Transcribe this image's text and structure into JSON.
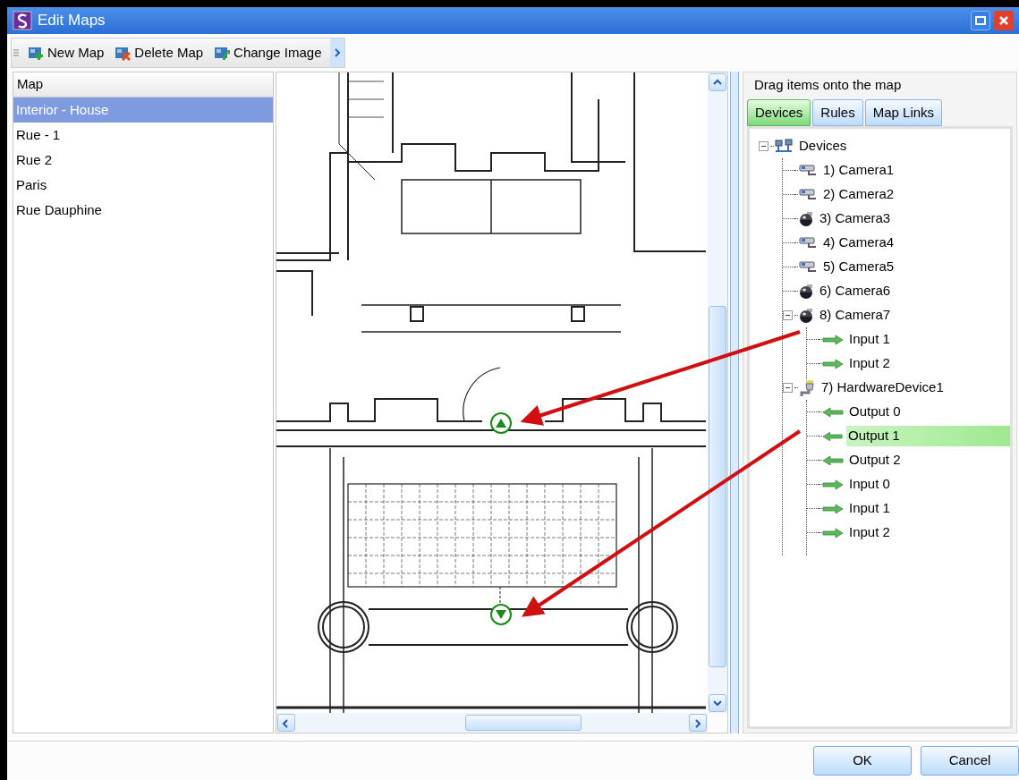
{
  "window": {
    "title": "Edit Maps"
  },
  "toolbar": [
    {
      "label": "New Map",
      "kind": "new"
    },
    {
      "label": "Delete Map",
      "kind": "delete"
    },
    {
      "label": "Change Image",
      "kind": "change"
    }
  ],
  "map_list": {
    "header": "Map",
    "items": [
      {
        "label": "Interior - House",
        "selected": true
      },
      {
        "label": "Rue - 1",
        "selected": false
      },
      {
        "label": "Rue 2",
        "selected": false
      },
      {
        "label": "Paris",
        "selected": false
      },
      {
        "label": "Rue Dauphine",
        "selected": false
      }
    ]
  },
  "panel": {
    "hint": "Drag items onto the map",
    "tabs": [
      {
        "label": "Devices",
        "selected": true
      },
      {
        "label": "Rules",
        "selected": false
      },
      {
        "label": "Map Links",
        "selected": false
      }
    ],
    "tree": [
      {
        "label": "Devices",
        "kind": "network",
        "expanded": true,
        "selected": false,
        "children": [
          {
            "label": "1) Camera1",
            "kind": "box-camera",
            "selected": false
          },
          {
            "label": "2) Camera2",
            "kind": "box-camera",
            "selected": false
          },
          {
            "label": "3) Camera3",
            "kind": "dome-camera",
            "selected": false
          },
          {
            "label": "4) Camera4",
            "kind": "box-camera",
            "selected": false
          },
          {
            "label": "5) Camera5",
            "kind": "box-camera",
            "selected": false
          },
          {
            "label": "6) Camera6",
            "kind": "dome-camera",
            "selected": false
          },
          {
            "label": "8) Camera7",
            "kind": "dome-camera",
            "expanded": true,
            "selected": false,
            "children": [
              {
                "label": "Input 1",
                "kind": "input",
                "selected": false
              },
              {
                "label": "Input 2",
                "kind": "input",
                "selected": false
              }
            ]
          },
          {
            "label": "7) HardwareDevice1",
            "kind": "hardware",
            "expanded": true,
            "selected": false,
            "children": [
              {
                "label": "Output 0",
                "kind": "output",
                "selected": false
              },
              {
                "label": "Output 1",
                "kind": "output",
                "selected": true
              },
              {
                "label": "Output 2",
                "kind": "output",
                "selected": false
              },
              {
                "label": "Input 0",
                "kind": "input",
                "selected": false
              },
              {
                "label": "Input 1",
                "kind": "input",
                "selected": false
              },
              {
                "label": "Input 2",
                "kind": "input",
                "selected": false
              }
            ]
          }
        ]
      }
    ]
  },
  "buttons": [
    "OK",
    "Cancel"
  ]
}
